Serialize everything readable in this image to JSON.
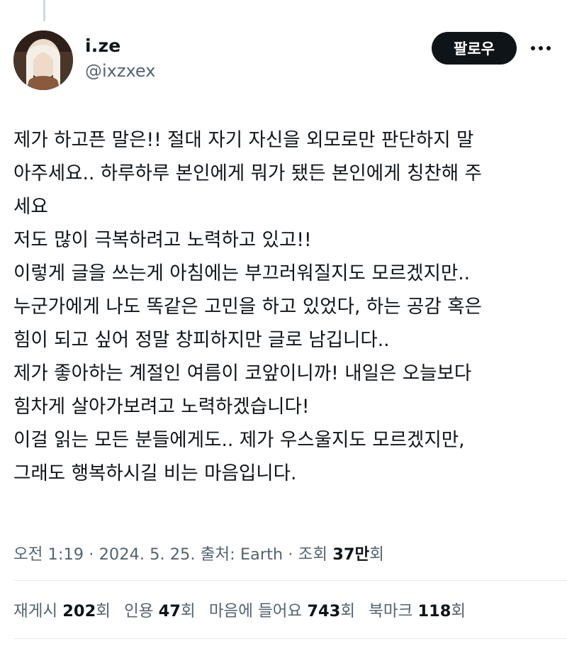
{
  "author": {
    "display_name": "i.ze",
    "handle": "@ixzxex",
    "avatar_icon": "profile-photo"
  },
  "actions": {
    "follow_label": "팔로우",
    "more_icon": "more-horizontal-icon"
  },
  "tweet": {
    "lines": [
      "제가 하고픈 말은!! 절대 자기 자신을 외모로만 판단하지 말",
      "아주세요.. 하루하루 본인에게 뭐가 됐든 본인에게 칭찬해 주",
      "세요",
      "저도 많이 극복하려고 노력하고 있고!!",
      "이렇게 글을 쓰는게 아침에는 부끄러워질지도 모르겠지만..",
      "누군가에게 나도 똑같은 고민을 하고 있었다, 하는 공감 혹은",
      "힘이 되고 싶어 정말 창피하지만 글로 남깁니다..",
      "제가 좋아하는 계절인 여름이 코앞이니까! 내일은 오늘보다",
      "힘차게 살아가보려고 노력하겠습니다!",
      "이걸 읽는 모든 분들에게도.. 제가 우스울지도 모르겠지만,",
      "그래도 행복하시길 비는 마음입니다."
    ]
  },
  "meta": {
    "time": "오전 1:19",
    "sep": " · ",
    "date": "2024. 5. 25.",
    "source": "출처: Earth",
    "views_label": "조회",
    "views_count": "37만",
    "views_suffix": "회"
  },
  "stats": {
    "reposts": {
      "count": "202",
      "label_before": "재게시",
      "suffix": "회"
    },
    "quotes": {
      "count": "47",
      "label_before": "인용",
      "suffix": "회"
    },
    "likes": {
      "count": "743",
      "label_before": "마음에 들어요",
      "suffix": "회"
    },
    "bookmarks": {
      "count": "118",
      "label_before": "북마크",
      "suffix": "회"
    }
  },
  "colors": {
    "text_primary": "#0f1419",
    "text_secondary": "#536471",
    "button_bg": "#0f1419",
    "divider": "#e6ecf0"
  }
}
